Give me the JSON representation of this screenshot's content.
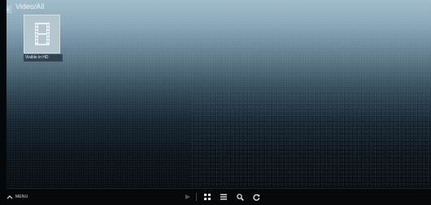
{
  "header": {
    "title": "Video/All",
    "icon": "hamburger-icon"
  },
  "library": {
    "items": [
      {
        "label": "Visible in HD",
        "icon": "film-strip-icon"
      }
    ]
  },
  "toolbar": {
    "menu_label": "MENU",
    "menu_icon": "chevron-up-icon",
    "buttons": [
      "play-icon",
      "grid-view-icon",
      "list-view-icon",
      "search-icon",
      "refresh-icon"
    ]
  },
  "colors": {
    "background_top": "#9fbccb",
    "background_bottom": "#07090c",
    "toolbar": "#060809",
    "icon": "#dfe7ec",
    "icon_disabled": "#4a555c"
  }
}
